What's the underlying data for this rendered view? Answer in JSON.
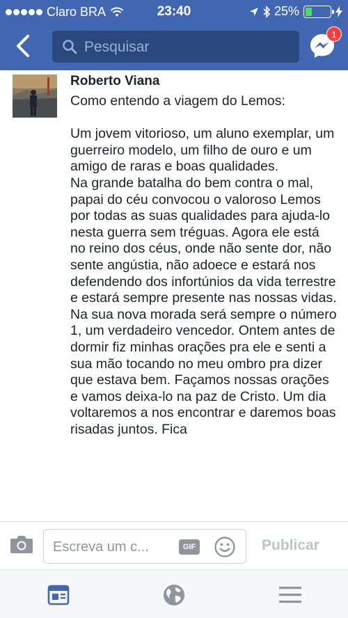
{
  "status_bar": {
    "carrier": "Claro BRA",
    "time": "23:40",
    "battery": "25%",
    "battery_level": 0.25,
    "signal_dots": 5
  },
  "header": {
    "search_placeholder": "Pesquisar",
    "messenger_badge": "1"
  },
  "comment": {
    "author": "Roberto Viana",
    "text": "Como entendo a viagem do Lemos:\n\nUm jovem vitorioso, um aluno exemplar, um guerreiro modelo, um filho de ouro e um amigo de raras e boas qualidades.\nNa grande batalha do bem contra o mal, papai do céu convocou o valoroso Lemos por todas as suas qualidades para ajuda-lo nesta guerra sem tréguas. Agora ele está no reino dos céus, onde não sente dor, não sente angústia, não adoece e estará nos defendendo dos infortúnios da vida terrestre e estará sempre presente nas nossas vidas. Na sua nova morada será sempre o número 1, um verdadeiro vencedor. Ontem antes de dormir fiz minhas orações pra ele e senti a sua mão tocando no meu ombro pra dizer que estava bem. Façamos nossas orações e vamos deixa-lo na paz de Cristo. Um dia voltaremos a nos encontrar e daremos boas risadas juntos. Fica"
  },
  "composer": {
    "placeholder": "Escreva um c...",
    "gif_label": "GIF",
    "publish_label": "Publicar"
  },
  "colors": {
    "brand_blue": "#4267b2",
    "search_bg": "#29487d",
    "badge_red": "#fa3e3e",
    "battery_green": "#4cd964"
  },
  "icons": [
    "back-chevron-icon",
    "search-icon",
    "messenger-icon",
    "camera-icon",
    "emoji-icon",
    "news-feed-icon",
    "globe-icon",
    "menu-icon"
  ]
}
